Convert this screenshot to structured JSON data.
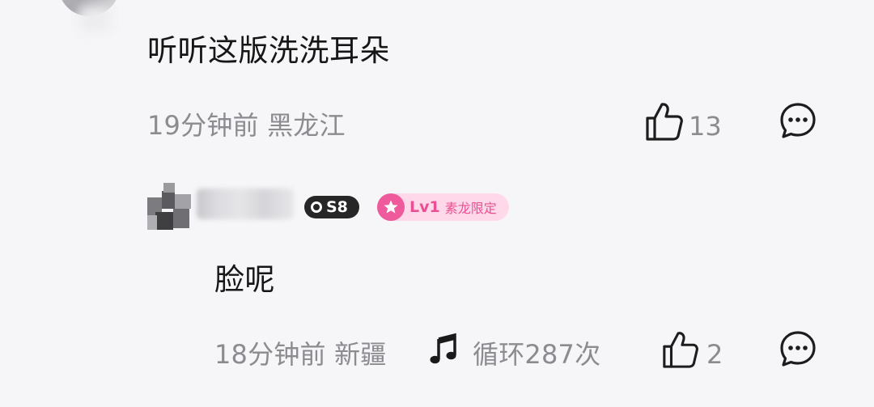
{
  "comment1": {
    "text": "听听这版洗洗耳朵",
    "time_location": "19分钟前 黑龙江",
    "like_count": "13"
  },
  "comment2": {
    "badge_s8": "S8",
    "badge_level": "Lv1",
    "badge_level_title": "素龙限定",
    "text": "脸呢",
    "time_location": "18分钟前 新疆",
    "music_note_label": "循环287次",
    "like_count": "2"
  },
  "colors": {
    "meta_gray": "#8b8b90",
    "level_pink": "#ee5a9c",
    "level_bg": "#ffd9ea",
    "badge_dark": "#262626"
  },
  "icons": [
    "thumbs-up-icon",
    "comment-bubble-icon",
    "music-note-icon",
    "star-icon"
  ]
}
